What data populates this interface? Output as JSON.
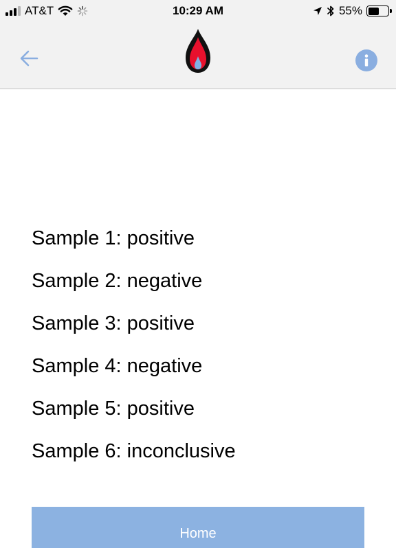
{
  "status_bar": {
    "carrier": "AT&T",
    "time": "10:29 AM",
    "battery_percent": "55%",
    "battery_level": 0.55,
    "icons": [
      "signal-icon",
      "wifi-icon",
      "activity-spinner-icon",
      "location-arrow-icon",
      "bluetooth-icon",
      "battery-icon"
    ]
  },
  "nav_bar": {
    "back_icon": "back-arrow-icon",
    "logo_icon": "flame-logo-icon",
    "info_icon": "info-icon"
  },
  "results": [
    "Sample 1: positive",
    "Sample 2: negative",
    "Sample 3: positive",
    "Sample 4: negative",
    "Sample 5: positive",
    "Sample 6: inconclusive"
  ],
  "home_button": {
    "label": "Home"
  },
  "colors": {
    "accent": "#8aaee0",
    "button": "#8cb2e1",
    "bar_background": "#f2f2f2",
    "logo_red": "#e8112d",
    "logo_black": "#111111",
    "logo_blue": "#7fb2e5"
  }
}
